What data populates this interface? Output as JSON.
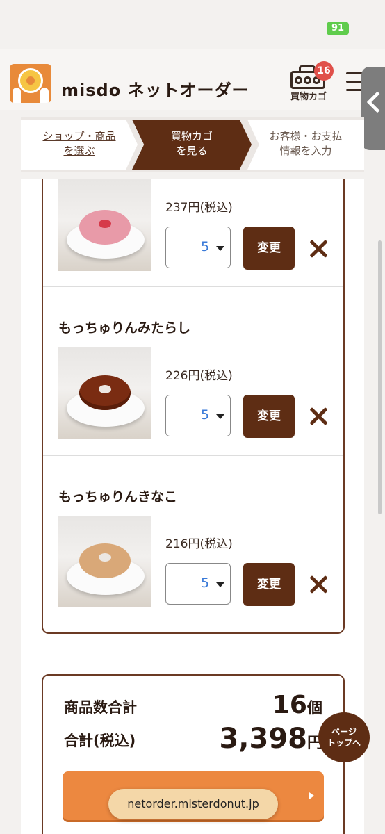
{
  "status_bar": {
    "battery": "91"
  },
  "header": {
    "title": "misdo ネットオーダー",
    "cart_label": "買物カゴ",
    "cart_count": "16"
  },
  "steps": [
    {
      "line1": "ショップ・商品",
      "line2": "を選ぶ"
    },
    {
      "line1": "買物カゴ",
      "line2": "を見る"
    },
    {
      "line1": "お客様・お支払",
      "line2": "情報を入力"
    }
  ],
  "items": [
    {
      "name": "",
      "price": "237円(税込)",
      "qty": "5",
      "change_label": "変更"
    },
    {
      "name": "もっちゅりんみたらし",
      "price": "226円(税込)",
      "qty": "5",
      "change_label": "変更"
    },
    {
      "name": "もっちゅりんきなこ",
      "price": "216円(税込)",
      "qty": "5",
      "change_label": "変更"
    }
  ],
  "summary": {
    "count_label": "商品数合計",
    "count_value": "16",
    "count_unit": "個",
    "total_label": "合計(税込)",
    "total_value": "3,398",
    "total_unit": "円"
  },
  "page_top": {
    "line1": "ページ",
    "line2": "トップへ"
  },
  "url": "netorder.misterdonut.jp"
}
